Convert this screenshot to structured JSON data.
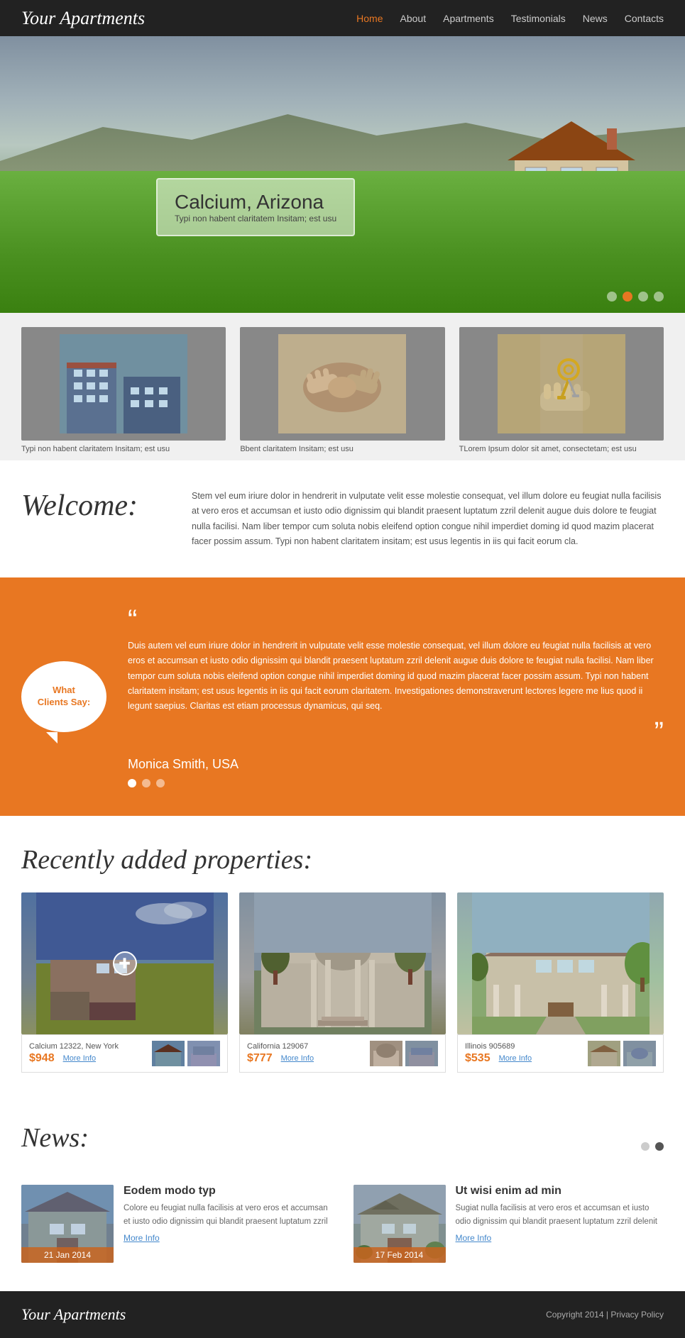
{
  "site": {
    "logo": "Your Apartments",
    "footer_logo": "Your Apartments",
    "copyright": "Copyright 2014 | Privacy Policy"
  },
  "nav": {
    "items": [
      {
        "label": "Home",
        "active": true
      },
      {
        "label": "About",
        "active": false
      },
      {
        "label": "Apartments",
        "active": false
      },
      {
        "label": "Testimonials",
        "active": false
      },
      {
        "label": "News",
        "active": false
      },
      {
        "label": "Contacts",
        "active": false
      }
    ]
  },
  "hero": {
    "location": "Calcium, Arizona",
    "subtitle": "Typi non habent claritatem Insitam; est usu",
    "dots": [
      1,
      2,
      3,
      4
    ],
    "active_dot": 1
  },
  "features": [
    {
      "caption": "Typi non habent claritatem Insitam; est usu"
    },
    {
      "caption": "Bbent claritatem Insitam; est usu"
    },
    {
      "caption": "TLorem Ipsum dolor sit amet, consectetam; est usu"
    }
  ],
  "welcome": {
    "title": "Welcome:",
    "text": "Stem vel eum iriure dolor in hendrerit in vulputate velit esse molestie consequat, vel illum dolore eu feugiat nulla facilisis at vero eros et accumsan et iusto odio dignissim qui blandit praesent luptatum zzril delenit augue duis dolore te feugiat nulla facilisi. Nam liber tempor cum soluta nobis eleifend option congue nihil imperdiet doming id quod mazim placerat facer possim assum. Typi non habent claritatem insitam; est usus legentis in iis qui facit eorum cla."
  },
  "testimonials": {
    "label_line1": "What",
    "label_line2": "Clients Say:",
    "quote": "Duis autem vel eum iriure dolor in hendrerit in vulputate velit esse molestie consequat, vel illum dolore eu feugiat nulla facilisis at vero eros et accumsan et iusto odio dignissim qui blandit praesent luptatum zzril delenit augue duis dolore te feugiat nulla facilisi. Nam liber tempor cum soluta nobis eleifend option congue nihil imperdiet doming id quod mazim placerat facer possim assum. Typi non habent claritatem insitam; est usus legentis in iis qui facit eorum claritatem. Investigationes demonstraverunt lectores legere me lius quod ii legunt saepius. Claritas est etiam processus dynamicus, qui seq.",
    "author": "Monica Smith, USA",
    "dots": [
      1,
      2,
      3
    ],
    "active_dot": 0
  },
  "properties": {
    "title": "Recently added properties:",
    "items": [
      {
        "location": "Calcium 12322, New York",
        "price": "$948",
        "more_info": "More Info"
      },
      {
        "location": "California 129067",
        "price": "$777",
        "more_info": "More Info"
      },
      {
        "location": "Illinois 905689",
        "price": "$535",
        "more_info": "More Info"
      }
    ]
  },
  "news": {
    "title": "News:",
    "items": [
      {
        "title": "Eodem modo typ",
        "text": "Colore eu feugiat nulla facilisis at vero eros et accumsan et iusto odio dignissim qui blandit praesent luptatum zzril",
        "date": "21 Jan 2014",
        "more": "More Info"
      },
      {
        "title": "Ut wisi enim ad min",
        "text": "Sugiat nulla facilisis at vero eros et accumsan et iusto odio dignissim qui blandit praesent luptatum zzril delenit",
        "date": "17 Feb 2014",
        "more": "More Info"
      }
    ],
    "dots": [
      1,
      2
    ],
    "active_dot": 1
  }
}
